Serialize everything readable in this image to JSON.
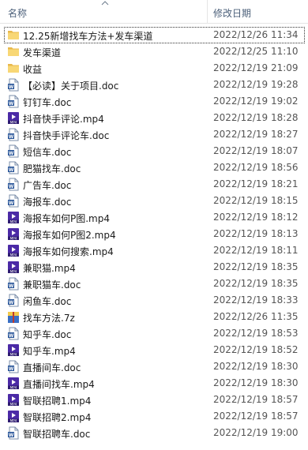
{
  "columns": {
    "name": "名称",
    "date_modified": "修改日期"
  },
  "files": [
    {
      "name": "12.25新增找车方法+发车渠道",
      "date": "2022/12/26 11:34",
      "type": "folder",
      "selected": true
    },
    {
      "name": "发车渠道",
      "date": "2022/12/25 11:10",
      "type": "folder"
    },
    {
      "name": "收益",
      "date": "2022/12/19 21:09",
      "type": "folder"
    },
    {
      "name": "【必读】关于项目.doc",
      "date": "2022/12/19 19:28",
      "type": "doc"
    },
    {
      "name": "钉钉车.doc",
      "date": "2022/12/19 19:02",
      "type": "doc"
    },
    {
      "name": "抖音快手评论.mp4",
      "date": "2022/12/19 18:28",
      "type": "mp4"
    },
    {
      "name": "抖音快手评论车.doc",
      "date": "2022/12/19 18:27",
      "type": "doc"
    },
    {
      "name": "短信车.doc",
      "date": "2022/12/19 18:07",
      "type": "doc"
    },
    {
      "name": "肥猫找车.doc",
      "date": "2022/12/19 18:56",
      "type": "doc"
    },
    {
      "name": "广告车.doc",
      "date": "2022/12/19 18:21",
      "type": "doc"
    },
    {
      "name": "海报车.doc",
      "date": "2022/12/19 18:15",
      "type": "doc"
    },
    {
      "name": "海报车如何P图.mp4",
      "date": "2022/12/19 18:12",
      "type": "mp4"
    },
    {
      "name": "海报车如何P图2.mp4",
      "date": "2022/12/19 18:13",
      "type": "mp4"
    },
    {
      "name": "海报车如何搜索.mp4",
      "date": "2022/12/19 18:11",
      "type": "mp4"
    },
    {
      "name": "兼职猫.mp4",
      "date": "2022/12/19 18:35",
      "type": "mp4"
    },
    {
      "name": "兼职猫车.doc",
      "date": "2022/12/19 18:35",
      "type": "doc"
    },
    {
      "name": "闲鱼车.doc",
      "date": "2022/12/19 18:33",
      "type": "doc"
    },
    {
      "name": "找车方法.7z",
      "date": "2022/12/26 11:35",
      "type": "archive"
    },
    {
      "name": "知乎车.doc",
      "date": "2022/12/19 18:53",
      "type": "doc"
    },
    {
      "name": "知乎车.mp4",
      "date": "2022/12/19 18:52",
      "type": "mp4"
    },
    {
      "name": "直播间车.doc",
      "date": "2022/12/19 18:30",
      "type": "doc"
    },
    {
      "name": "直播间找车.mp4",
      "date": "2022/12/19 18:30",
      "type": "mp4"
    },
    {
      "name": "智联招聘1.mp4",
      "date": "2022/12/19 18:57",
      "type": "mp4"
    },
    {
      "name": "智联招聘2.mp4",
      "date": "2022/12/19 18:57",
      "type": "mp4"
    },
    {
      "name": "智联招聘车.doc",
      "date": "2022/12/19 19:00",
      "type": "doc"
    }
  ],
  "icon_names": {
    "folder": "folder-icon",
    "doc": "word-doc-icon",
    "mp4": "video-file-icon",
    "archive": "archive-7z-icon"
  },
  "colors": {
    "folder": "#f8d775",
    "doc_blue": "#2b579a",
    "video_purple": "#5a2fb5"
  }
}
